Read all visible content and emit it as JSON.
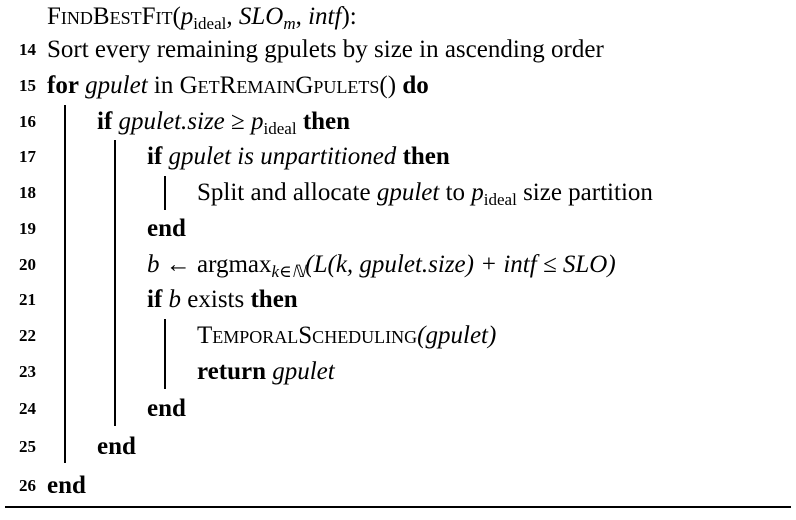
{
  "algorithm": {
    "header": {
      "name": "FindBestFit",
      "open": "(",
      "p": "p",
      "p_sub": "ideal",
      "sep1": ", ",
      "slo": "SLO",
      "slo_sub": "m",
      "sep2": ", ",
      "intf": "intf",
      "close": "):"
    },
    "lines": [
      {
        "num": "14",
        "text": "Sort every remaining gpulets by size in ascending order"
      },
      {
        "num": "15",
        "kw_for": "for",
        "var": "gpulet",
        "in": " in ",
        "fn": "GetRemainGpulets",
        "paren": "()",
        "kw_do": "do"
      },
      {
        "num": "16",
        "kw_if": "if",
        "cond_a": "gpulet.size",
        "op": " ≥ ",
        "p": "p",
        "p_sub": "ideal",
        "kw_then": "then"
      },
      {
        "num": "17",
        "kw_if": "if",
        "cond": "gpulet is unpartitioned",
        "kw_then": "then"
      },
      {
        "num": "18",
        "t1": "Split and allocate ",
        "var": "gpulet",
        "t2": " to ",
        "p": "p",
        "p_sub": "ideal",
        "t3": " size partition"
      },
      {
        "num": "19",
        "kw": "end"
      },
      {
        "num": "20",
        "b": "b",
        "arrow": " ← argmax",
        "sub": "k∈ℕ",
        "expr": "(L(k, gpulet.size) + intf ≤ SLO)"
      },
      {
        "num": "21",
        "kw_if": "if",
        "b": "b",
        "t": " exists ",
        "kw_then": "then"
      },
      {
        "num": "22",
        "fn": "TemporalScheduling",
        "arg": "(gpulet)"
      },
      {
        "num": "23",
        "kw": "return",
        "var": "gpulet"
      },
      {
        "num": "24",
        "kw": "end"
      },
      {
        "num": "25",
        "kw": "end"
      },
      {
        "num": "26",
        "kw": "end"
      }
    ]
  }
}
